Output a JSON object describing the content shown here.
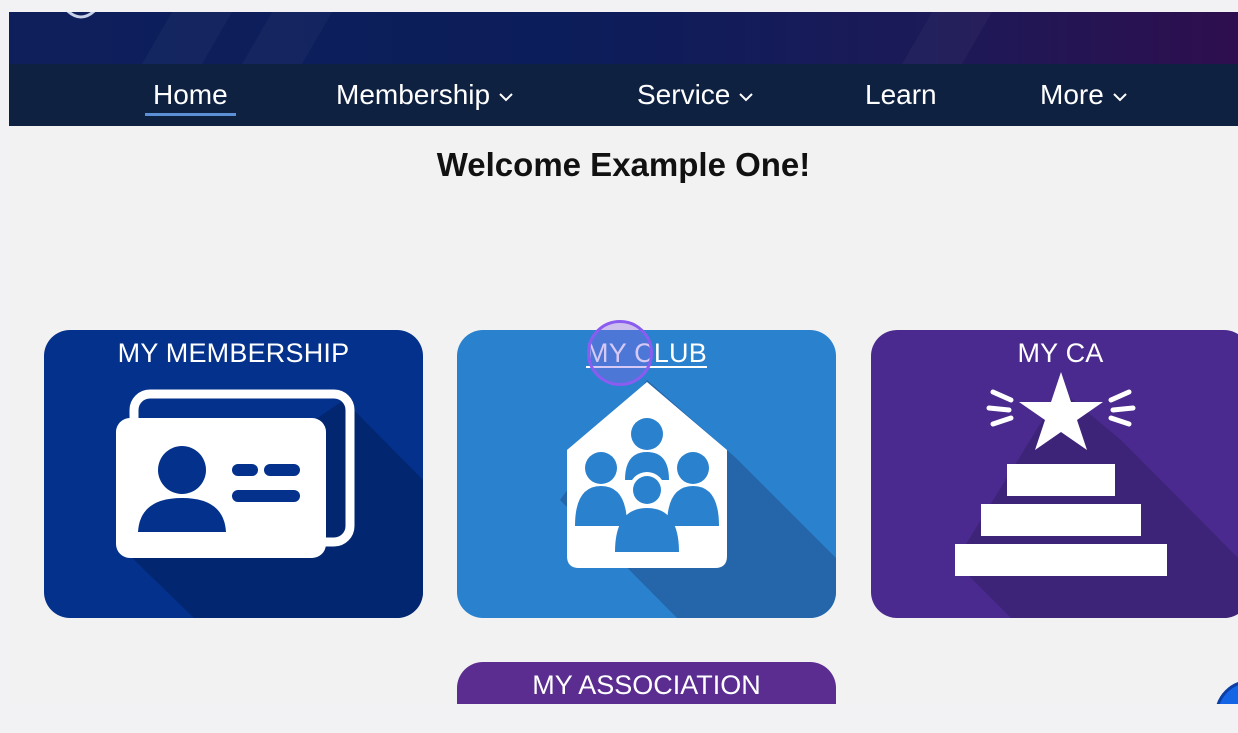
{
  "nav": {
    "home": "Home",
    "membership": "Membership",
    "service": "Service",
    "learn": "Learn",
    "more": "More"
  },
  "welcome": "Welcome Example One!",
  "tiles": {
    "membership": "MY MEMBERSHIP",
    "club": "MY CLUB",
    "ca": "MY CA",
    "association": "MY ASSOCIATION"
  },
  "icons": {
    "membership": "id-card-icon",
    "club": "group-house-icon",
    "ca": "star-podium-icon",
    "chevron": "chevron-down-icon"
  },
  "colors": {
    "navbar": "#0e2141",
    "membership_tile": "#03318c",
    "club_tile": "#2a82cf",
    "ca_tile": "#4a2a8e",
    "association_tile": "#5b2d91"
  }
}
